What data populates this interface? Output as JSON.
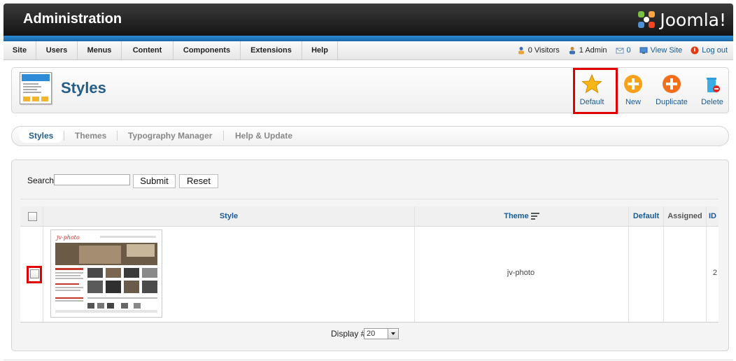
{
  "header": {
    "title": "Administration",
    "brand": "Joomla!"
  },
  "menu": {
    "items": [
      "Site",
      "Users",
      "Menus",
      "Content",
      "Components",
      "Extensions",
      "Help"
    ]
  },
  "status": {
    "visitors": "0 Visitors",
    "admin": "1 Admin",
    "messages": "0",
    "view_site": "View Site",
    "logout": "Log out"
  },
  "toolbar": {
    "title": "Styles",
    "buttons": {
      "default": "Default",
      "new": "New",
      "duplicate": "Duplicate",
      "delete": "Delete"
    }
  },
  "tabs": [
    "Styles",
    "Themes",
    "Typography Manager",
    "Help & Update"
  ],
  "filter": {
    "search_label": "Search",
    "search_value": "",
    "submit": "Submit",
    "reset": "Reset"
  },
  "table": {
    "headers": {
      "style": "Style",
      "theme": "Theme",
      "default": "Default",
      "assigned": "Assigned",
      "id": "ID"
    },
    "rows": [
      {
        "theme": "jv-photo",
        "id": "2",
        "thumb_logo": "jv-photo"
      }
    ]
  },
  "pagination": {
    "display_label": "Display #",
    "display_value": "20"
  },
  "colors": {
    "accent": "#235d88",
    "link": "#1a5a96",
    "highlight": "#e00000",
    "header_bar": "#1766a8"
  }
}
